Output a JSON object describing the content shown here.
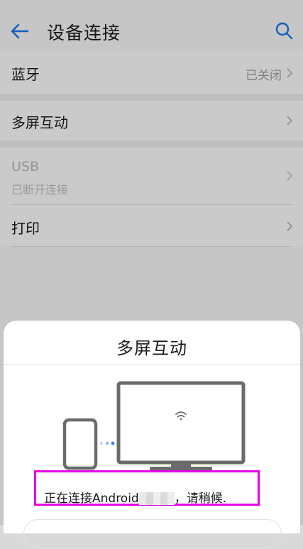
{
  "header": {
    "title": "设备连接",
    "back_icon": "arrow-left-icon",
    "search_icon": "search-icon",
    "accent_color": "#1a73e8"
  },
  "settings": {
    "bluetooth": {
      "label": "蓝牙",
      "value": "已关闭"
    },
    "multi_screen": {
      "label": "多屏互动"
    },
    "usb": {
      "label": "USB",
      "sub": "已断开连接"
    },
    "print": {
      "label": "打印"
    }
  },
  "sheet": {
    "title": "多屏互动",
    "status_prefix": "正在连接Android",
    "status_suffix": "，请稍候.",
    "highlight_color": "#e600e6"
  }
}
